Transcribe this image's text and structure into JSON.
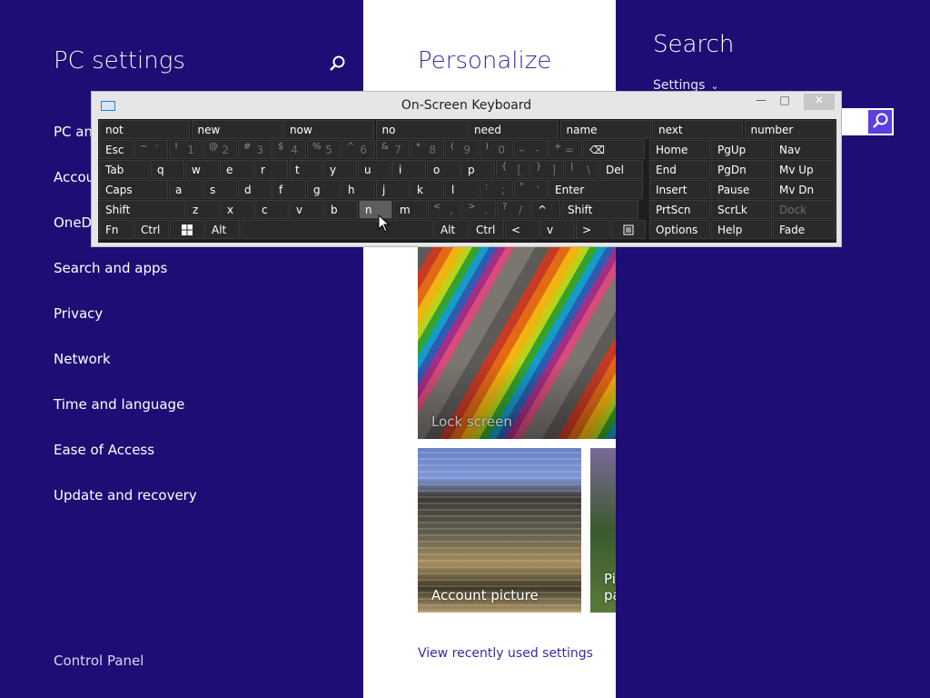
{
  "left": {
    "title": "PC settings",
    "items": [
      "PC and devices",
      "Accounts",
      "OneDrive",
      "Search and apps",
      "Privacy",
      "Network",
      "Time and language",
      "Ease of Access",
      "Update and recovery"
    ],
    "control_panel": "Control Panel"
  },
  "middle": {
    "heading": "Personalize",
    "tiles": [
      "Lock screen",
      "Account picture",
      "Picture password"
    ],
    "view_link": "View recently used settings"
  },
  "right": {
    "title": "Search",
    "scope": "Settings"
  },
  "osk": {
    "title": "On-Screen Keyboard",
    "predictions": [
      "not",
      "new",
      "now",
      "no",
      "need",
      "name",
      "next",
      "number"
    ],
    "row1": [
      {
        "label": "Esc"
      },
      {
        "sec": "~",
        "pri": "`"
      },
      {
        "sec": "!",
        "pri": "1"
      },
      {
        "sec": "@",
        "pri": "2"
      },
      {
        "sec": "#",
        "pri": "3"
      },
      {
        "sec": "$",
        "pri": "4"
      },
      {
        "sec": "%",
        "pri": "5"
      },
      {
        "sec": "^",
        "pri": "6"
      },
      {
        "sec": "&",
        "pri": "7"
      },
      {
        "sec": "*",
        "pri": "8"
      },
      {
        "sec": "(",
        "pri": "9"
      },
      {
        "sec": ")",
        "pri": "0"
      },
      {
        "sec": "_",
        "pri": "-"
      },
      {
        "sec": "+",
        "pri": "="
      },
      {
        "label": "⌫"
      }
    ],
    "row2": [
      "Tab",
      "q",
      "w",
      "e",
      "r",
      "t",
      "y",
      "u",
      "i",
      "o",
      "p",
      {
        "sec": "{",
        "pri": "["
      },
      {
        "sec": "}",
        "pri": "]"
      },
      {
        "sec": "|",
        "pri": "\\"
      },
      "Del"
    ],
    "row3": [
      "Caps",
      "a",
      "s",
      "d",
      "f",
      "g",
      "h",
      "j",
      "k",
      "l",
      {
        "sec": ":",
        "pri": ";"
      },
      {
        "sec": "\"",
        "pri": "'"
      },
      "Enter"
    ],
    "row4": [
      "Shift",
      "z",
      "x",
      "c",
      "v",
      "b",
      "n",
      "m",
      {
        "sec": "<",
        "pri": ","
      },
      {
        "sec": ">",
        "pri": "."
      },
      {
        "sec": "?",
        "pri": "/"
      },
      "^",
      "Shift"
    ],
    "row5": [
      "Fn",
      "Ctrl",
      "win",
      "Alt",
      "",
      "Alt",
      "Ctrl",
      "<",
      "v",
      ">",
      "menu"
    ],
    "nav": [
      [
        "Home",
        "PgUp",
        "Nav"
      ],
      [
        "End",
        "PgDn",
        "Mv Up"
      ],
      [
        "Insert",
        "Pause",
        "Mv Dn"
      ],
      [
        "PrtScn",
        "ScrLk",
        "Dock"
      ],
      [
        "Options",
        "Help",
        "Fade"
      ]
    ],
    "pressed_key": "n"
  }
}
